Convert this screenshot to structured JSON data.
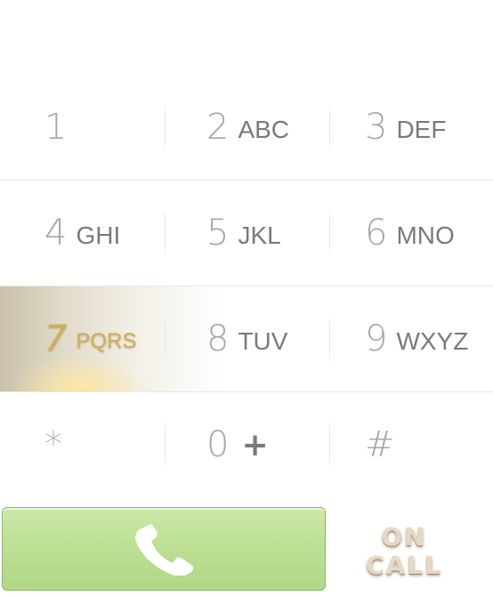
{
  "keypad": {
    "rows": [
      [
        {
          "digit": "1",
          "letters": ""
        },
        {
          "digit": "2",
          "letters": "ABC"
        },
        {
          "digit": "3",
          "letters": "DEF"
        }
      ],
      [
        {
          "digit": "4",
          "letters": "GHI"
        },
        {
          "digit": "5",
          "letters": "JKL"
        },
        {
          "digit": "6",
          "letters": "MNO"
        }
      ],
      [
        {
          "digit": "7",
          "letters": "PQRS"
        },
        {
          "digit": "8",
          "letters": "TUV"
        },
        {
          "digit": "9",
          "letters": "WXYZ"
        }
      ],
      [
        {
          "digit": "*",
          "letters": ""
        },
        {
          "digit": "0",
          "letters": "+"
        },
        {
          "digit": "#",
          "letters": ""
        }
      ]
    ],
    "active_key": "7"
  },
  "call_button": {
    "icon": "phone-handset-icon",
    "color": "#bde095"
  },
  "on_call": {
    "line1": "ON",
    "line2": "CALL"
  }
}
